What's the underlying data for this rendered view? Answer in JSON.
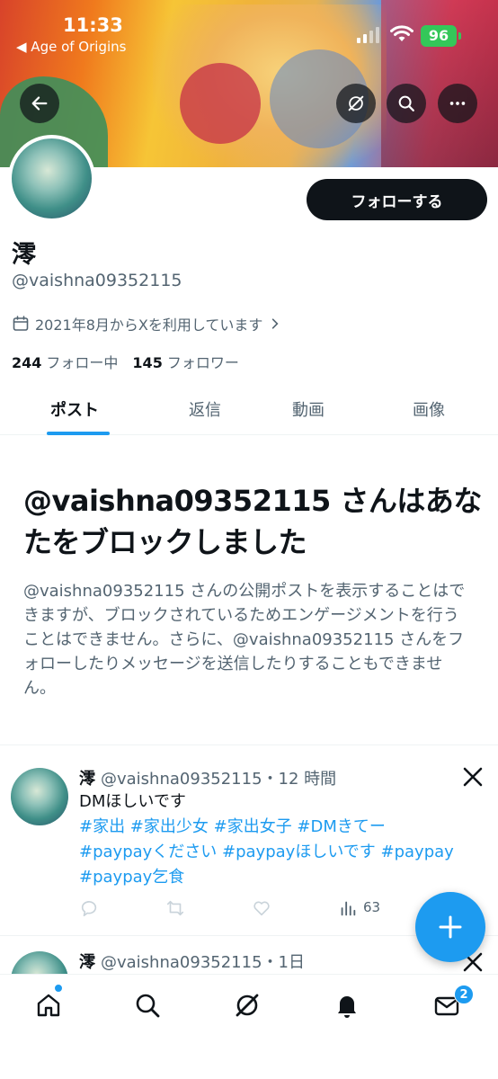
{
  "status_bar": {
    "time": "11:33",
    "back_app": "◀ Age of Origins",
    "battery": "96"
  },
  "profile": {
    "name": "澪",
    "handle": "@vaishna09352115",
    "joined": "2021年8月からXを利用しています",
    "following_count": "244",
    "following_label": "フォロー中",
    "followers_count": "145",
    "followers_label": "フォロワー",
    "follow_button": "フォローする"
  },
  "tabs": [
    {
      "label": "ポスト",
      "active": true
    },
    {
      "label": "返信",
      "active": false
    },
    {
      "label": "動画",
      "active": false
    },
    {
      "label": "画像",
      "active": false
    }
  ],
  "block_notice": {
    "title": "@vaishna09352115 さんはあなたをブロックしました",
    "description": "@vaishna09352115 さんの公開ポストを表示することはできますが、ブロックされているためエンゲージメントを行うことはできません。さらに、@vaishna09352115 さんをフォローしたりメッセージを送信したりすることもできません。"
  },
  "tweets": [
    {
      "name": "澪",
      "meta": "@vaishna09352115・12 時間",
      "text": "DMほしいです",
      "hashtags_line1": "#家出 #家出少女 #家出女子 #DMきてー",
      "hashtags_line2": "#paypayください #paypayほしいです #paypay",
      "hashtags_line3": "#paypay乞食",
      "views": "63"
    },
    {
      "name": "澪",
      "meta": "@vaishna09352115・1日"
    }
  ],
  "bottom_nav": {
    "messages_badge": "2"
  },
  "colors": {
    "accent": "#1d9bf0",
    "text_primary": "#0f1419",
    "text_secondary": "#536471",
    "battery": "#34c759"
  },
  "icons": [
    "back-arrow-icon",
    "grok-icon",
    "search-icon",
    "more-icon",
    "calendar-icon",
    "chevron-right-icon",
    "x-logo-icon",
    "reply-icon",
    "repost-icon",
    "like-icon",
    "views-icon",
    "plus-icon",
    "home-icon",
    "bell-icon",
    "mail-icon"
  ]
}
